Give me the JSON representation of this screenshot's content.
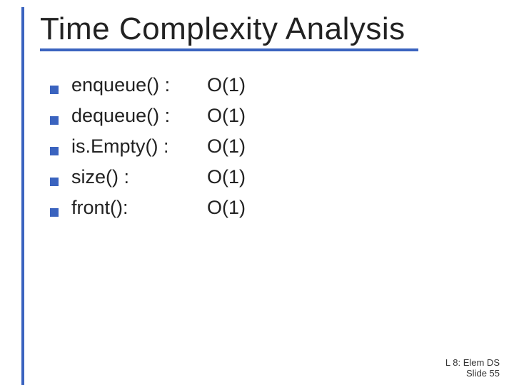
{
  "title": "Time Complexity Analysis",
  "items": [
    {
      "op": "enqueue() :",
      "val": "O(1)"
    },
    {
      "op": "dequeue() :",
      "val": "O(1)"
    },
    {
      "op": "is.Empty() :",
      "val": "O(1)"
    },
    {
      "op": "size() :",
      "val": "O(1)"
    },
    {
      "op": "front():",
      "val": "O(1)"
    }
  ],
  "footer": {
    "line1": "L 8: Elem DS",
    "line2": "Slide 55"
  },
  "colors": {
    "accent": "#3a63bf",
    "text": "#222222"
  }
}
